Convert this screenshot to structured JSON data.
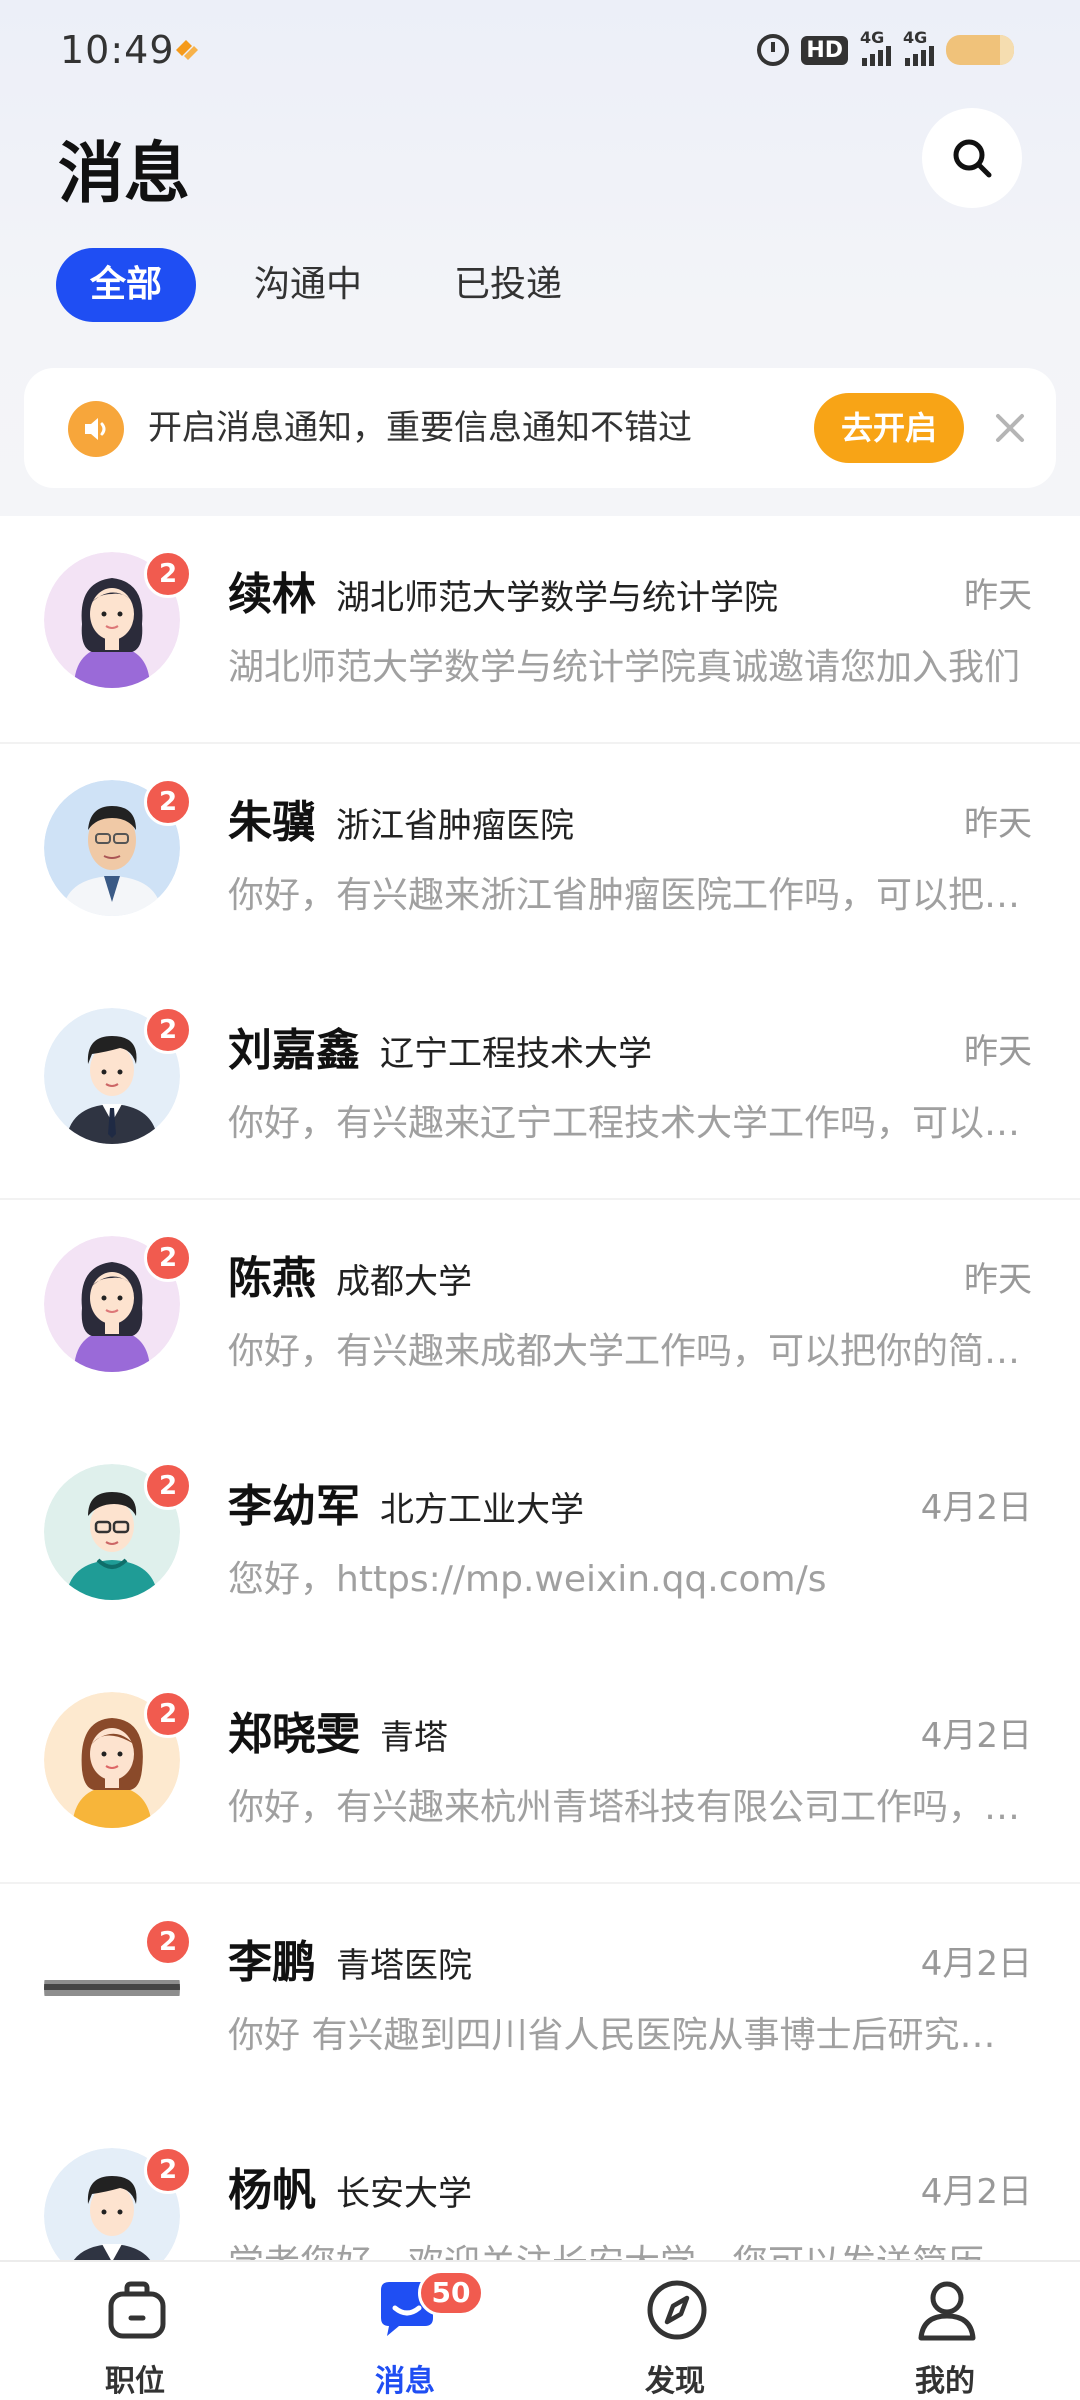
{
  "status_bar": {
    "time": "10:49",
    "hd_label": "HD",
    "net1": "4G",
    "net2": "4G"
  },
  "header": {
    "title": "消息",
    "search_icon": "search-icon"
  },
  "tabs": [
    {
      "label": "全部",
      "active": true
    },
    {
      "label": "沟通中",
      "active": false
    },
    {
      "label": "已投递",
      "active": false
    }
  ],
  "notice": {
    "text": "开启消息通知，重要信息通知不错过",
    "button_label": "去开启",
    "icon": "speaker-icon",
    "close_icon": "close-icon"
  },
  "chats": [
    {
      "name": "续林",
      "org": "湖北师范大学数学与统计学院",
      "time": "昨天",
      "preview": "湖北师范大学数学与统计学院真诚邀请您加入我们",
      "unread": "2",
      "avatar": "female-avatar-purple"
    },
    {
      "name": "朱骥",
      "org": "浙江省肿瘤医院",
      "time": "昨天",
      "preview": "你好，有兴趣来浙江省肿瘤医院工作吗，可以把你的简历发给我",
      "unread": "2",
      "avatar": "doctor-photo-avatar"
    },
    {
      "name": "刘嘉鑫",
      "org": "辽宁工程技术大学",
      "time": "昨天",
      "preview": "你好，有兴趣来辽宁工程技术大学工作吗，可以把你的简历发给我",
      "unread": "2",
      "avatar": "male-avatar-suit"
    },
    {
      "name": "陈燕",
      "org": "成都大学",
      "time": "昨天",
      "preview": "你好，有兴趣来成都大学工作吗，可以把你的简历发给我",
      "unread": "2",
      "avatar": "female-avatar-purple"
    },
    {
      "name": "李幼军",
      "org": "北方工业大学",
      "time": "4月2日",
      "preview": "您好，https://mp.weixin.qq.com/s",
      "unread": "2",
      "avatar": "male-avatar-glasses"
    },
    {
      "name": "郑晓雯",
      "org": "青塔",
      "time": "4月2日",
      "preview": "你好，有兴趣来杭州青塔科技有限公司工作吗，可以把你的简历发给我",
      "unread": "2",
      "avatar": "female-avatar-yellow"
    },
    {
      "name": "李鹏",
      "org": "青塔医院",
      "time": "4月2日",
      "preview": "你好 有兴趣到四川省人民医院从事博士后研究工作吗",
      "unread": "2",
      "avatar": "blank-avatar"
    },
    {
      "name": "杨帆",
      "org": "长安大学",
      "time": "4月2日",
      "preview": "学者您好，欢迎关注长安大学，您可以发送简历",
      "unread": "2",
      "avatar": "male-avatar-suit"
    }
  ],
  "bottom_nav": [
    {
      "label": "职位",
      "icon": "briefcase-icon",
      "active": false
    },
    {
      "label": "消息",
      "icon": "message-icon",
      "active": true,
      "badge": "50"
    },
    {
      "label": "发现",
      "icon": "compass-icon",
      "active": false
    },
    {
      "label": "我的",
      "icon": "person-icon",
      "active": false
    }
  ],
  "colors": {
    "accent": "#1f4ef3",
    "badge": "#f15b4f",
    "notice_button": "#f8a416"
  }
}
